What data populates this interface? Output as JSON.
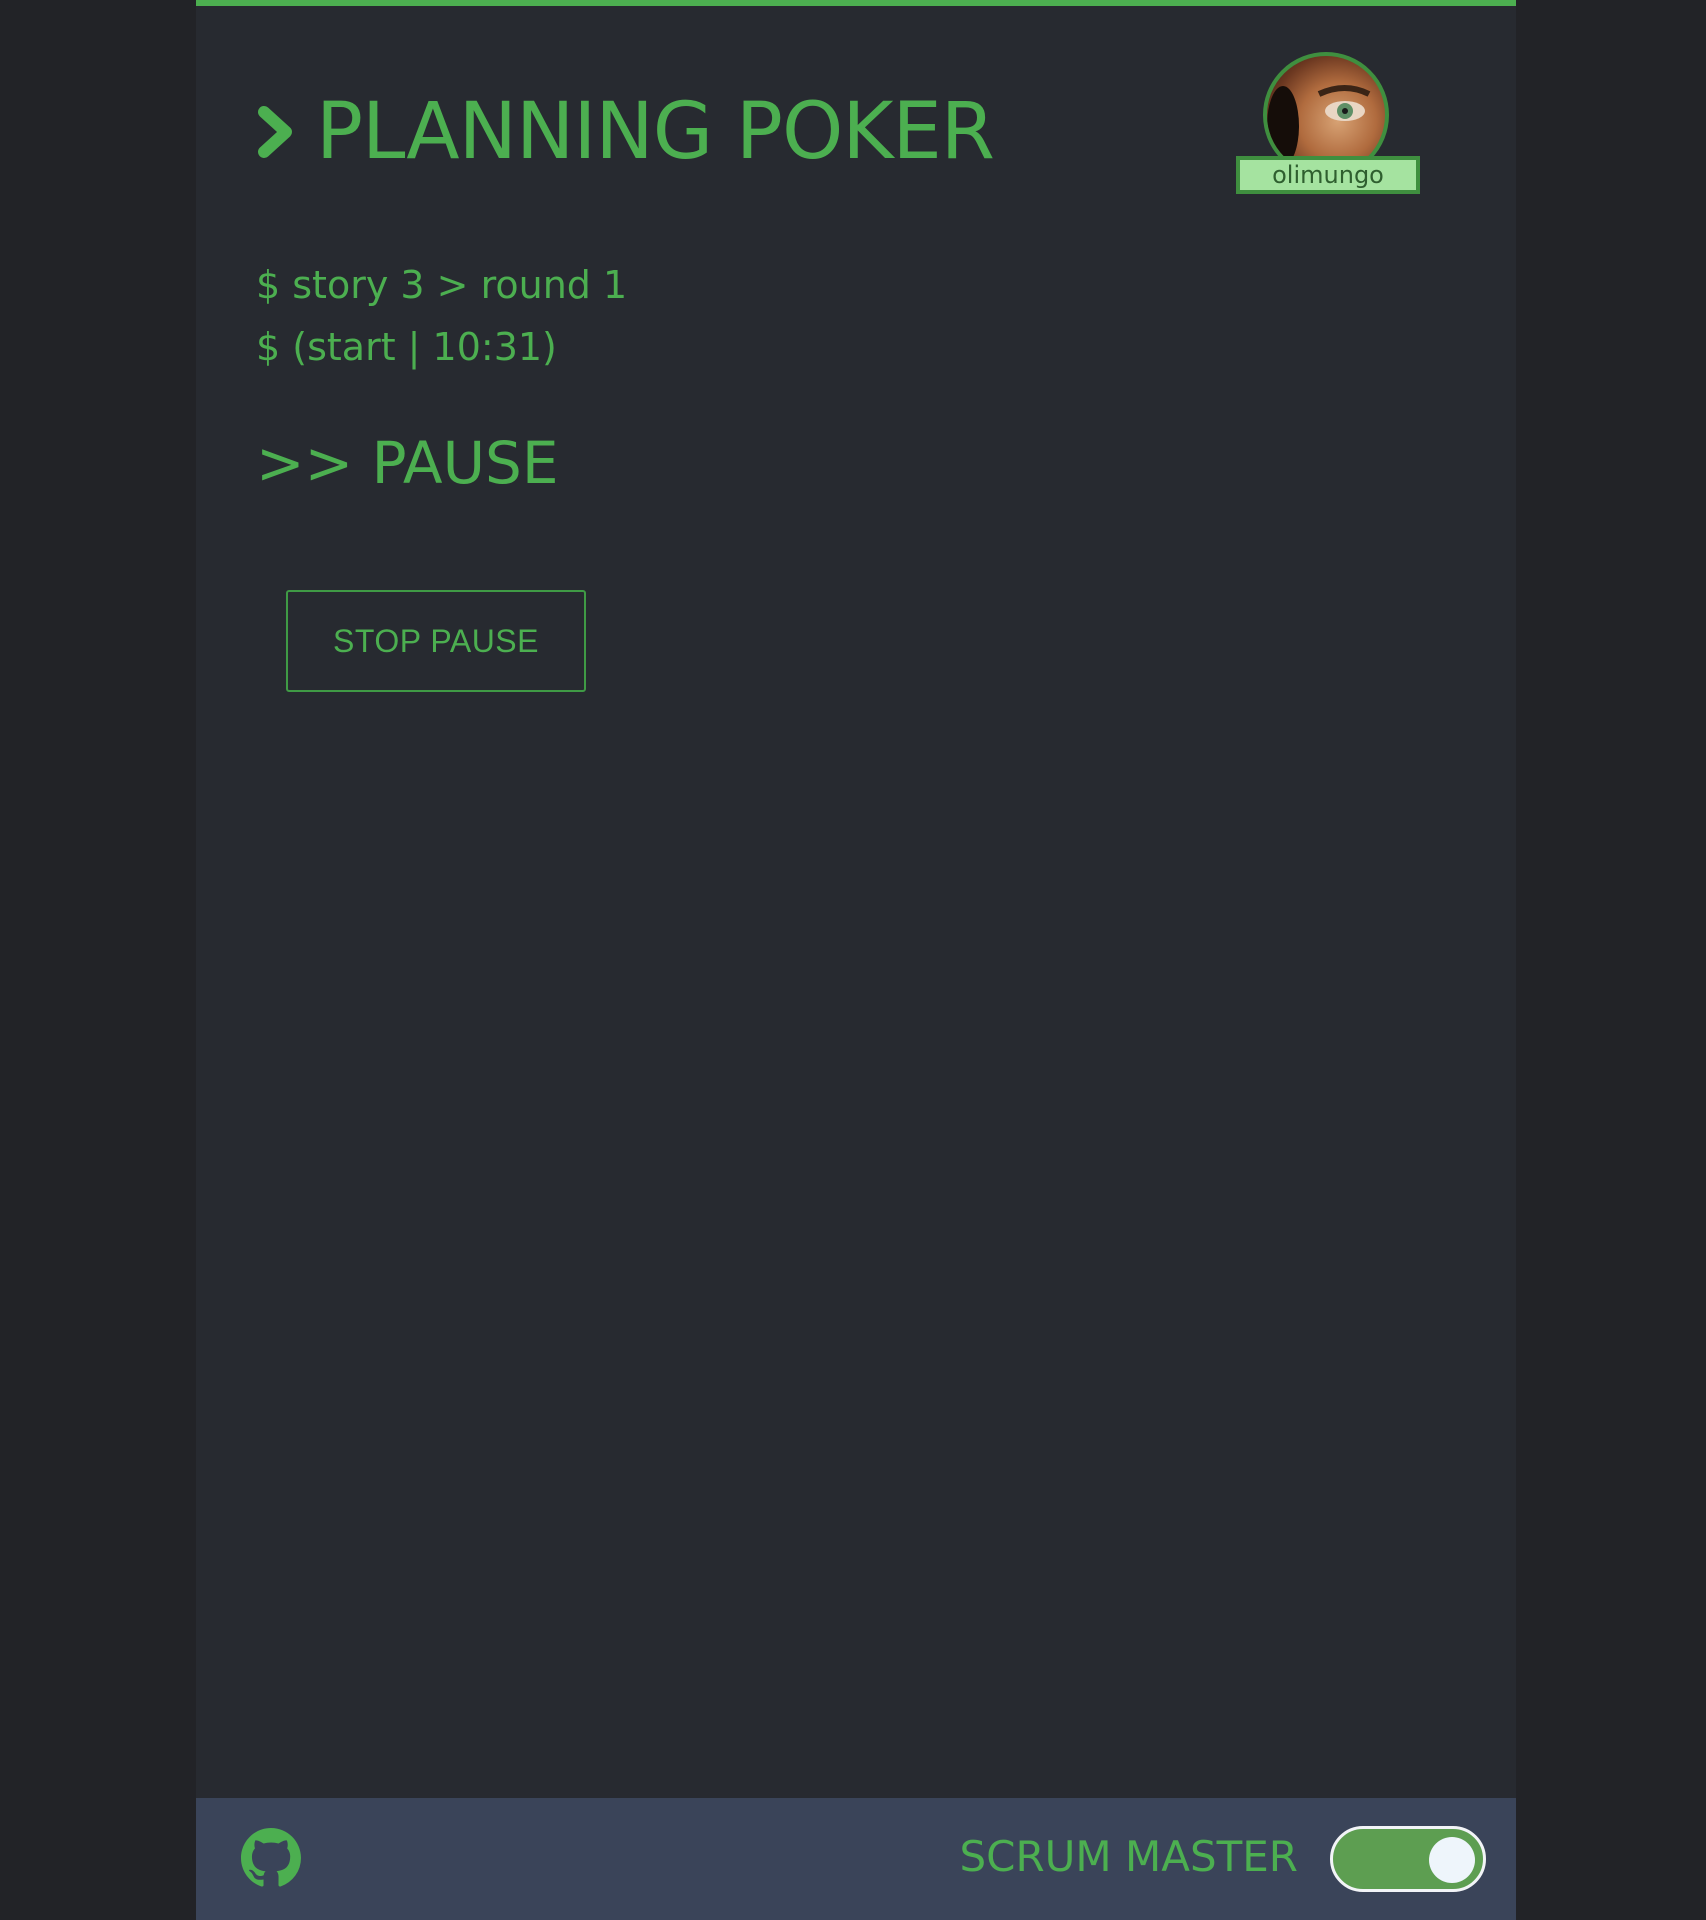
{
  "header": {
    "title": "PLANNING POKER",
    "username": "olimungo"
  },
  "session": {
    "story_line": "$ story 3 > round 1",
    "time_line": "$ (start | 10:31)",
    "state_label": ">> PAUSE"
  },
  "actions": {
    "stop_pause_label": "STOP PAUSE"
  },
  "footer": {
    "role_label": "SCRUM MASTER",
    "scrum_master_on": true,
    "icon": "github-icon"
  },
  "colors": {
    "accent": "#4caf50",
    "background": "#272a30",
    "footer": "#3a4459"
  }
}
